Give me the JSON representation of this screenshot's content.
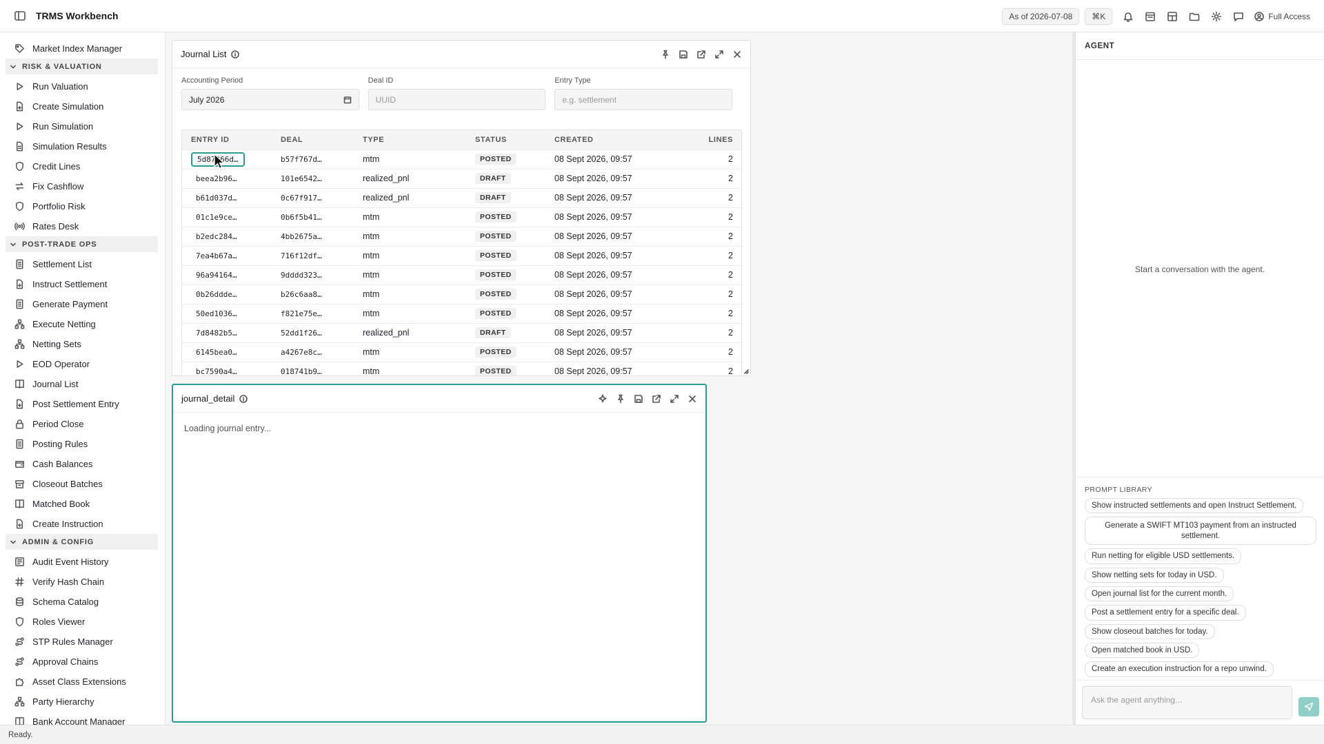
{
  "app": {
    "title": "TRMS Workbench"
  },
  "topbar": {
    "as_of": "As of 2026-07-08",
    "shortcut": "⌘K",
    "access": "Full Access"
  },
  "sidebar": {
    "items_top": [
      {
        "label": "Market Index Manager",
        "icon": "tag-icon"
      }
    ],
    "sections": [
      {
        "title": "RISK & VALUATION",
        "items": [
          {
            "label": "Run Valuation",
            "icon": "play-icon"
          },
          {
            "label": "Create Simulation",
            "icon": "file-plus-icon"
          },
          {
            "label": "Run Simulation",
            "icon": "play-icon"
          },
          {
            "label": "Simulation Results",
            "icon": "file-icon"
          },
          {
            "label": "Credit Lines",
            "icon": "shield-icon"
          },
          {
            "label": "Fix Cashflow",
            "icon": "arrows-icon"
          },
          {
            "label": "Portfolio Risk",
            "icon": "shield-icon"
          },
          {
            "label": "Rates Desk",
            "icon": "radio-icon"
          }
        ]
      },
      {
        "title": "POST-TRADE OPS",
        "items": [
          {
            "label": "Settlement List",
            "icon": "document-icon"
          },
          {
            "label": "Instruct Settlement",
            "icon": "file-plus-icon"
          },
          {
            "label": "Generate Payment",
            "icon": "document-icon"
          },
          {
            "label": "Execute Netting",
            "icon": "network-icon"
          },
          {
            "label": "Netting Sets",
            "icon": "network-icon"
          },
          {
            "label": "EOD Operator",
            "icon": "play-icon"
          },
          {
            "label": "Journal List",
            "icon": "book-icon"
          },
          {
            "label": "Post Settlement Entry",
            "icon": "file-plus-icon"
          },
          {
            "label": "Period Close",
            "icon": "lock-icon"
          },
          {
            "label": "Posting Rules",
            "icon": "document-icon"
          },
          {
            "label": "Cash Balances",
            "icon": "wallet-icon"
          },
          {
            "label": "Closeout Batches",
            "icon": "folder-icon"
          },
          {
            "label": "Matched Book",
            "icon": "book-icon"
          },
          {
            "label": "Create Instruction",
            "icon": "file-plus-icon"
          }
        ]
      },
      {
        "title": "ADMIN & CONFIG",
        "items": [
          {
            "label": "Audit Event History",
            "icon": "history-icon"
          },
          {
            "label": "Verify Hash Chain",
            "icon": "hash-icon"
          },
          {
            "label": "Schema Catalog",
            "icon": "database-icon"
          },
          {
            "label": "Roles Viewer",
            "icon": "shield-icon"
          },
          {
            "label": "STP Rules Manager",
            "icon": "route-icon"
          },
          {
            "label": "Approval Chains",
            "icon": "route-icon"
          },
          {
            "label": "Asset Class Extensions",
            "icon": "puzzle-icon"
          },
          {
            "label": "Party Hierarchy",
            "icon": "network-icon"
          },
          {
            "label": "Bank Account Manager",
            "icon": "book-icon"
          }
        ]
      }
    ]
  },
  "journal_list": {
    "title": "Journal List",
    "filters": {
      "period_label": "Accounting Period",
      "period_value": "July 2026",
      "deal_label": "Deal ID",
      "deal_placeholder": "UUID",
      "type_label": "Entry Type",
      "type_placeholder": "e.g. settlement"
    },
    "columns": [
      "ENTRY ID",
      "DEAL",
      "TYPE",
      "STATUS",
      "CREATED",
      "LINES"
    ],
    "rows": [
      [
        "5d87266d…",
        "b57f767d…",
        "mtm",
        "POSTED",
        "08 Sept 2026, 09:57",
        "2"
      ],
      [
        "beea2b96…",
        "101e6542…",
        "realized_pnl",
        "DRAFT",
        "08 Sept 2026, 09:57",
        "2"
      ],
      [
        "b61d037d…",
        "0c67f917…",
        "realized_pnl",
        "DRAFT",
        "08 Sept 2026, 09:57",
        "2"
      ],
      [
        "01c1e9ce…",
        "0b6f5b41…",
        "mtm",
        "POSTED",
        "08 Sept 2026, 09:57",
        "2"
      ],
      [
        "b2edc284…",
        "4bb2675a…",
        "mtm",
        "POSTED",
        "08 Sept 2026, 09:57",
        "2"
      ],
      [
        "7ea4b67a…",
        "716f12df…",
        "mtm",
        "POSTED",
        "08 Sept 2026, 09:57",
        "2"
      ],
      [
        "96a94164…",
        "9dddd323…",
        "mtm",
        "POSTED",
        "08 Sept 2026, 09:57",
        "2"
      ],
      [
        "0b26ddde…",
        "b26c6aa8…",
        "mtm",
        "POSTED",
        "08 Sept 2026, 09:57",
        "2"
      ],
      [
        "50ed1036…",
        "f821e75e…",
        "mtm",
        "POSTED",
        "08 Sept 2026, 09:57",
        "2"
      ],
      [
        "7d8482b5…",
        "52dd1f26…",
        "realized_pnl",
        "DRAFT",
        "08 Sept 2026, 09:57",
        "2"
      ],
      [
        "6145bea0…",
        "a4267e8c…",
        "mtm",
        "POSTED",
        "08 Sept 2026, 09:57",
        "2"
      ],
      [
        "bc7590a4…",
        "018741b9…",
        "mtm",
        "POSTED",
        "08 Sept 2026, 09:57",
        "2"
      ]
    ],
    "selected_row": 0
  },
  "journal_detail": {
    "title": "journal_detail",
    "loading": "Loading journal entry..."
  },
  "agent": {
    "title": "AGENT",
    "empty": "Start a conversation with the agent.",
    "prompt_library_label": "PROMPT LIBRARY",
    "prompts": [
      "Show instructed settlements and open Instruct Settlement.",
      "Generate a SWIFT MT103 payment from an instructed settlement.",
      "Run netting for eligible USD settlements.",
      "Show netting sets for today in USD.",
      "Open journal list for the current month.",
      "Post a settlement entry for a specific deal.",
      "Show closeout batches for today.",
      "Open matched book in USD.",
      "Create an execution instruction for a repo unwind."
    ],
    "input_placeholder": "Ask the agent anything..."
  },
  "status": {
    "text": "Ready."
  },
  "colors": {
    "accent": "#2a9d93",
    "send_button": "#8fcfc8"
  }
}
